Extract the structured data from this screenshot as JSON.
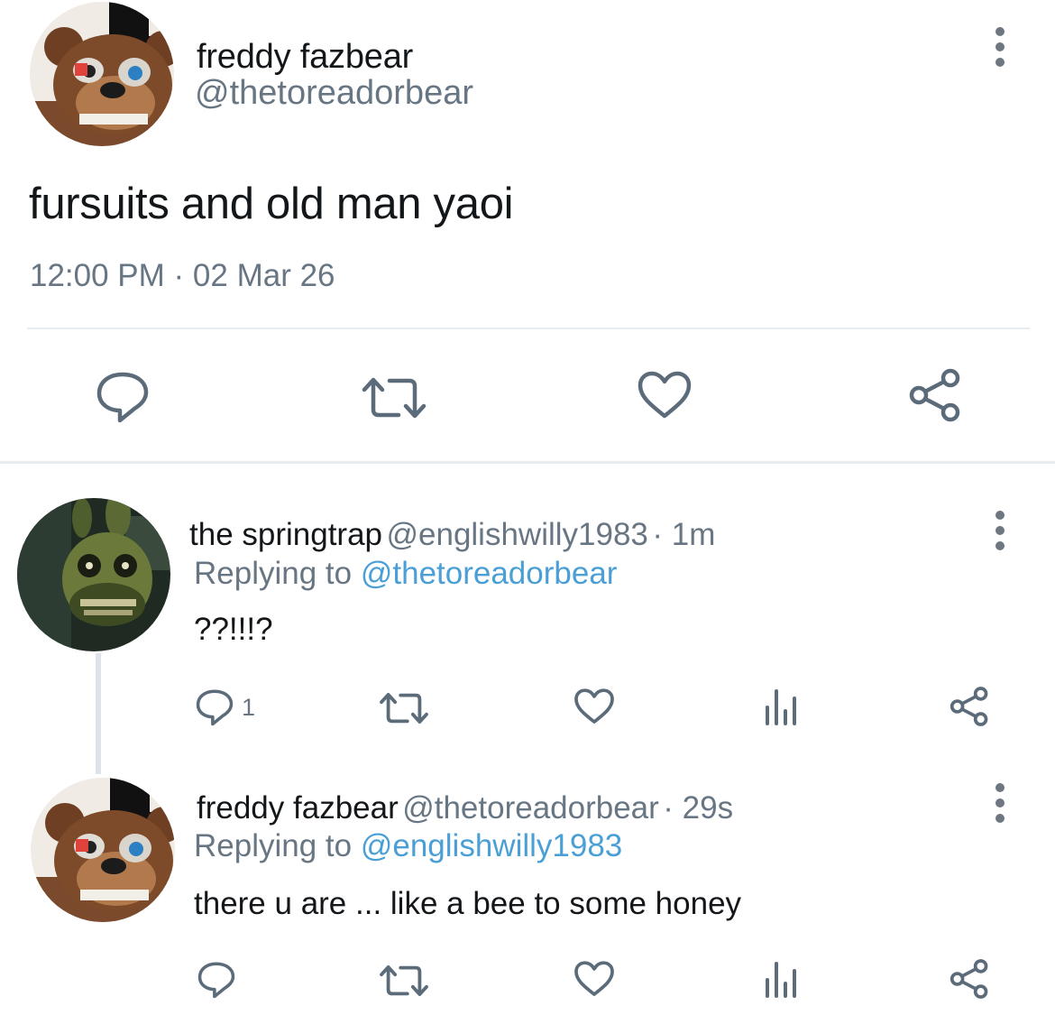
{
  "main_tweet": {
    "author": {
      "name": "freddy fazbear",
      "handle": "@thetoreadorbear",
      "avatar": "freddy-fazbear-avatar"
    },
    "text": "fursuits and old man yaoi",
    "timestamp": "12:00 PM · 02 Mar 26",
    "actions": [
      {
        "icon": "reply-icon"
      },
      {
        "icon": "retweet-icon"
      },
      {
        "icon": "like-icon"
      },
      {
        "icon": "share-icon"
      }
    ]
  },
  "replies": [
    {
      "author": {
        "name": "the springtrap",
        "handle": "@englishwilly1983",
        "avatar": "springtrap-avatar"
      },
      "time": "· 1m",
      "replying_label": "Replying to",
      "replying_to": "@thetoreadorbear",
      "text": "??!!!?",
      "reply_count": "1"
    },
    {
      "author": {
        "name": "freddy fazbear",
        "handle": "@thetoreadorbear",
        "avatar": "freddy-fazbear-avatar"
      },
      "time": "· 29s",
      "replying_label": "Replying to",
      "replying_to": "@englishwilly1983",
      "text": "there u are ... like a bee to some honey",
      "reply_count": ""
    }
  ],
  "colors": {
    "text": "#14171a",
    "secondary": "#687684",
    "mention": "#4a9fd6",
    "icon": "#5b6b7a",
    "divider": "#e6ecf0"
  }
}
